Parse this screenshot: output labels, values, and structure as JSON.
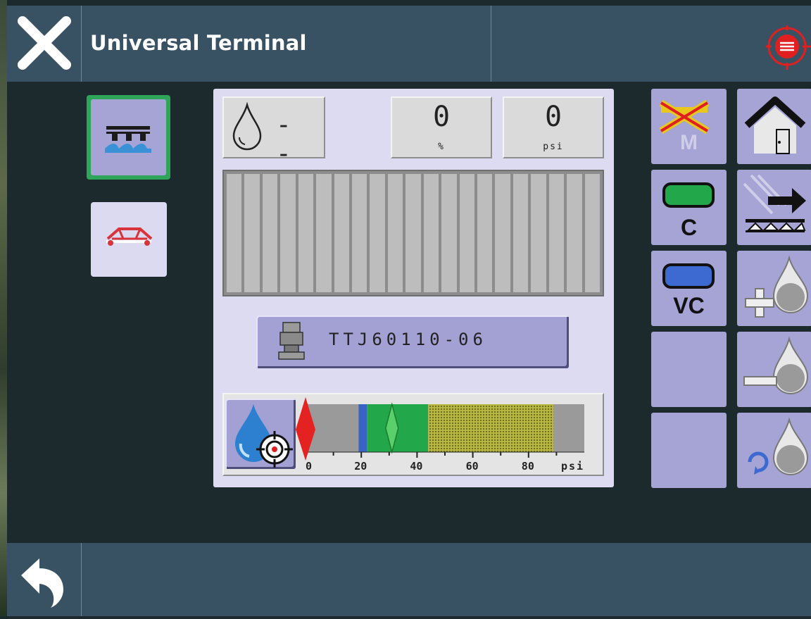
{
  "header": {
    "title": "Universal Terminal",
    "close_icon": "close-icon",
    "logo_icon": "ecu-logo-icon"
  },
  "footer": {
    "back_icon": "back-arrow-icon"
  },
  "side_buttons": [
    {
      "icon": "boom-spray-icon",
      "active": true
    },
    {
      "icon": "boom-fold-icon",
      "active": false
    }
  ],
  "readouts": {
    "flow_icon": "droplet-icon",
    "flow_value": "- -",
    "percent_value": "0",
    "percent_unit": "%",
    "pressure_value": "0",
    "pressure_unit": "psi"
  },
  "sections": {
    "count": 21,
    "state": "off"
  },
  "nozzle": {
    "icon": "nozzle-icon",
    "label": "TTJ60110-06"
  },
  "pressure_gauge": {
    "icon": "rate-target-icon",
    "unit": "psi",
    "ticks": [
      0,
      20,
      40,
      60,
      80
    ],
    "range": [
      0,
      100
    ],
    "bands": [
      {
        "from": 0,
        "to": 19,
        "color": "#9a9a9a"
      },
      {
        "from": 19,
        "to": 22,
        "color": "#3a64c4"
      },
      {
        "from": 22,
        "to": 44,
        "color": "#22a84a"
      },
      {
        "from": 44,
        "to": 89,
        "color": "#a8a83a",
        "pattern": "dotted"
      },
      {
        "from": 89,
        "to": 100,
        "color": "#9a9a9a"
      }
    ],
    "current_marker": 0,
    "target_marker": 31
  },
  "right_buttons": [
    {
      "icon": "manual-off-icon",
      "label": "M"
    },
    {
      "icon": "home-icon",
      "label": ""
    },
    {
      "icon": "auto-control-icon",
      "label": "C"
    },
    {
      "icon": "boom-next-icon",
      "label": ""
    },
    {
      "icon": "variable-control-icon",
      "label": "VC"
    },
    {
      "icon": "rate-increase-icon",
      "label": ""
    },
    {
      "icon": "",
      "label": ""
    },
    {
      "icon": "rate-decrease-icon",
      "label": ""
    },
    {
      "icon": "",
      "label": ""
    },
    {
      "icon": "rate-reset-icon",
      "label": ""
    }
  ],
  "colors": {
    "topbar": "#385163",
    "panel": "#dcdbf2",
    "button": "#a6a3d5",
    "active_border": "#2fa55a"
  }
}
